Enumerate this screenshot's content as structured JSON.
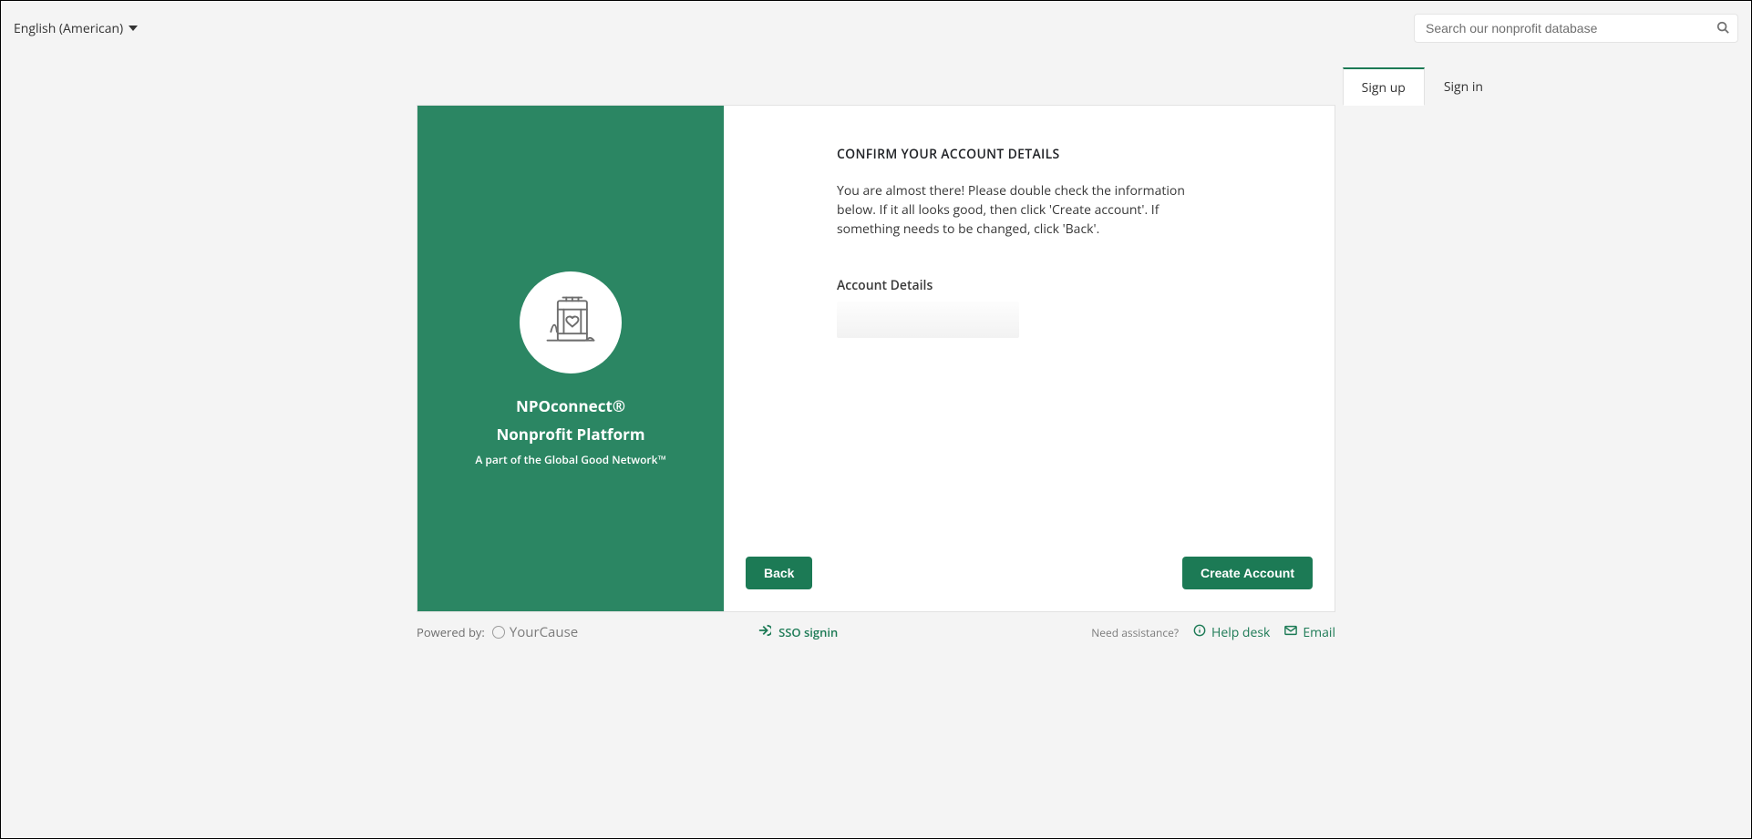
{
  "header": {
    "language": "English (American)",
    "search_placeholder": "Search our nonprofit database"
  },
  "tabs": {
    "signup": "Sign up",
    "signin": "Sign in"
  },
  "brand": {
    "title": "NPOconnect®",
    "subtitle": "Nonprofit Platform",
    "tagline": "A part of the Global Good Network™"
  },
  "main": {
    "heading": "CONFIRM YOUR ACCOUNT DETAILS",
    "instructions": "You are almost there! Please double check the information below. If it all looks good, then click 'Create account'. If something needs to be changed, click 'Back'.",
    "section_label": "Account Details"
  },
  "buttons": {
    "back": "Back",
    "create": "Create Account"
  },
  "footer": {
    "powered_by": "Powered by:",
    "powered_name": "YourCause",
    "sso": "SSO signin",
    "assist": "Need assistance?",
    "help": "Help desk",
    "email": "Email"
  }
}
